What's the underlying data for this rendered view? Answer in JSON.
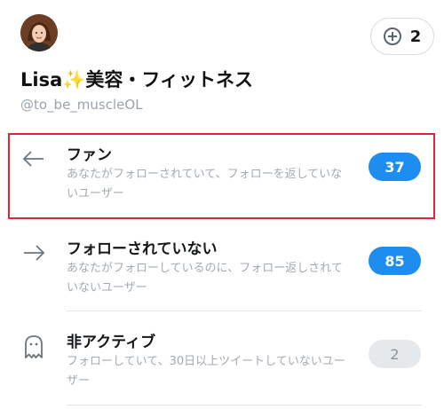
{
  "profile": {
    "display_name": "Lisa✨美容・フィットネス",
    "handle": "@to_be_muscleOL"
  },
  "account_switcher": {
    "count": "2",
    "icon": "plus-circle-icon"
  },
  "rows": [
    {
      "title": "ファン",
      "description": "あなたがフォローされていて、フォローを返していないユーザー",
      "count": "37",
      "icon": "arrow-left-icon",
      "highlighted": true
    },
    {
      "title": "フォローされていない",
      "description": "あなたがフォローしているのに、フォロー返しされていないユーザー",
      "count": "85",
      "icon": "arrow-right-icon"
    },
    {
      "title": "非アクティブ",
      "description": "フォローしていて、30日以上ツイートしていないユーザー",
      "count": "2",
      "icon": "ghost-icon"
    }
  ],
  "colors": {
    "accent": "#1d8ef0",
    "highlight": "#e0243a",
    "inactive_badge": "#e6e9ec"
  }
}
